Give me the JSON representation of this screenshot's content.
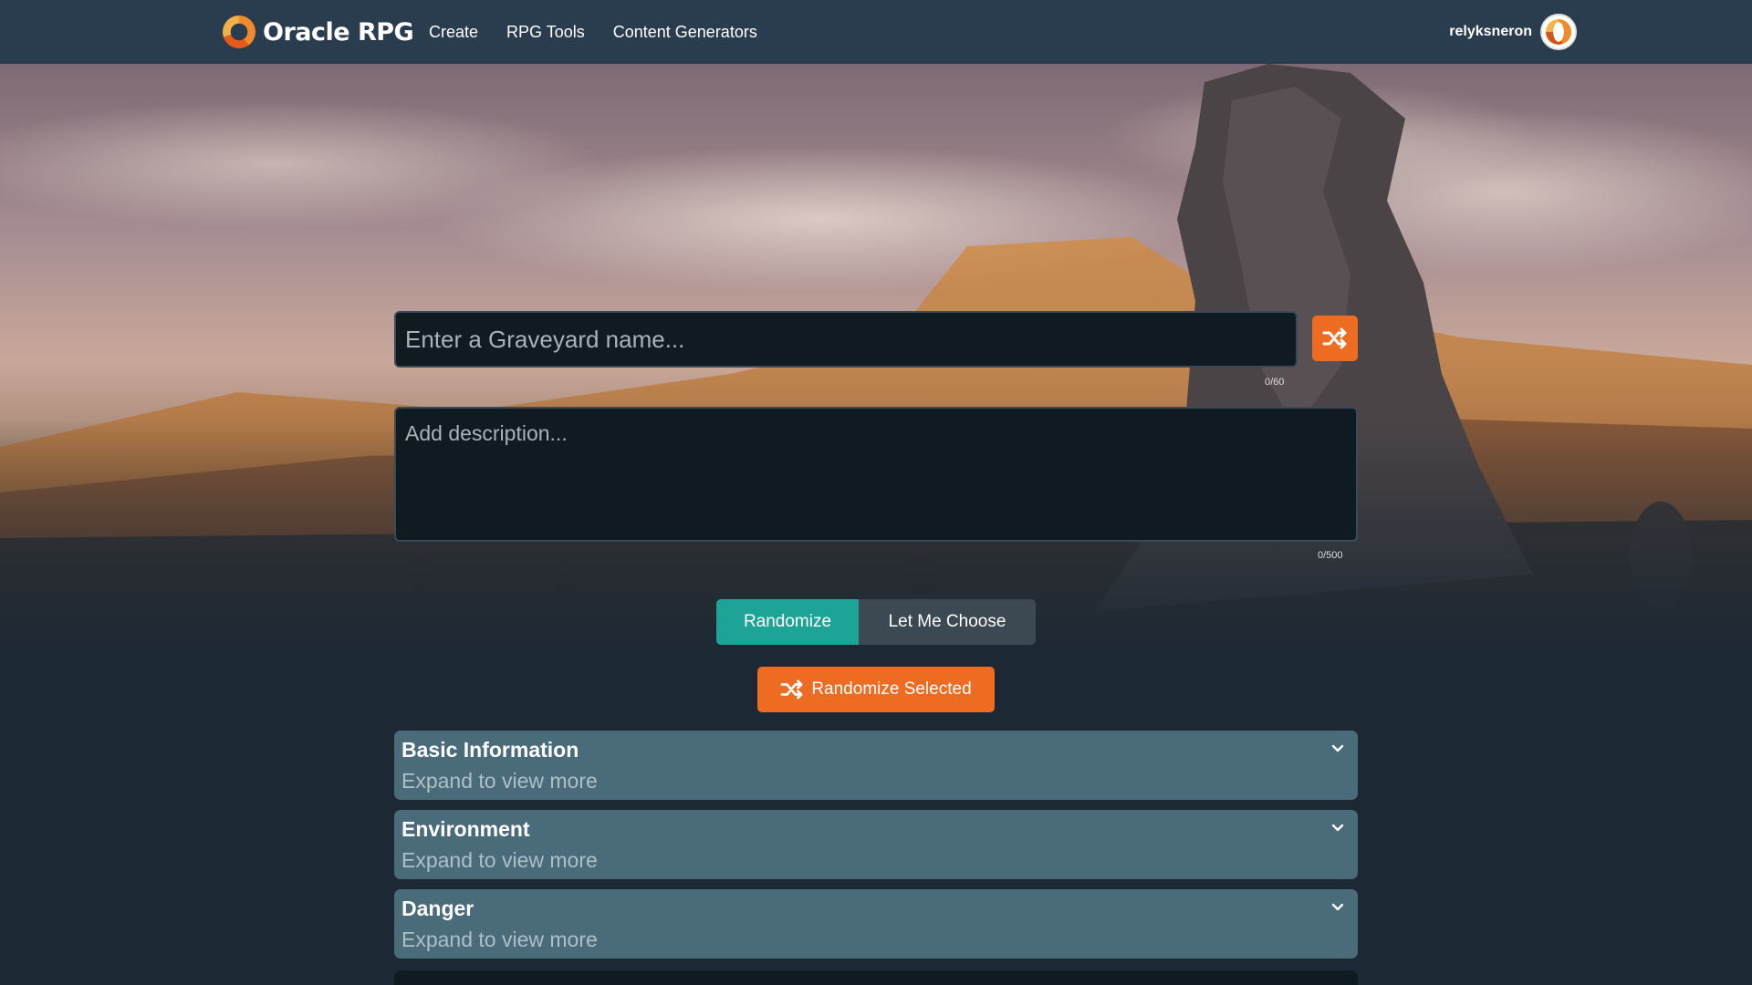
{
  "app": {
    "name": "Oracle RPG"
  },
  "nav": {
    "links": [
      "Create",
      "RPG Tools",
      "Content Generators"
    ]
  },
  "user": {
    "username": "relyksneron"
  },
  "form": {
    "name_placeholder": "Enter a Graveyard name...",
    "name_counter": "0/60",
    "description_placeholder": "Add description...",
    "description_counter": "0/500"
  },
  "mode": {
    "randomize_label": "Randomize",
    "choose_label": "Let Me Choose",
    "active": "Randomize"
  },
  "actions": {
    "randomize_selected_label": "Randomize Selected"
  },
  "sections": [
    {
      "title": "Basic Information",
      "subtitle": "Expand to view more"
    },
    {
      "title": "Environment",
      "subtitle": "Expand to view more"
    },
    {
      "title": "Danger",
      "subtitle": "Expand to view more"
    }
  ],
  "colors": {
    "navbar": "#2a3d4e",
    "accent_orange": "#ee6b22",
    "accent_teal": "#1ea496",
    "section_bg": "#4a6c7a",
    "page_bg": "#1c2833"
  },
  "icons": {
    "shuffle": "shuffle-icon",
    "chevron": "chevron-down-icon",
    "logo": "oracle-logo-icon"
  }
}
